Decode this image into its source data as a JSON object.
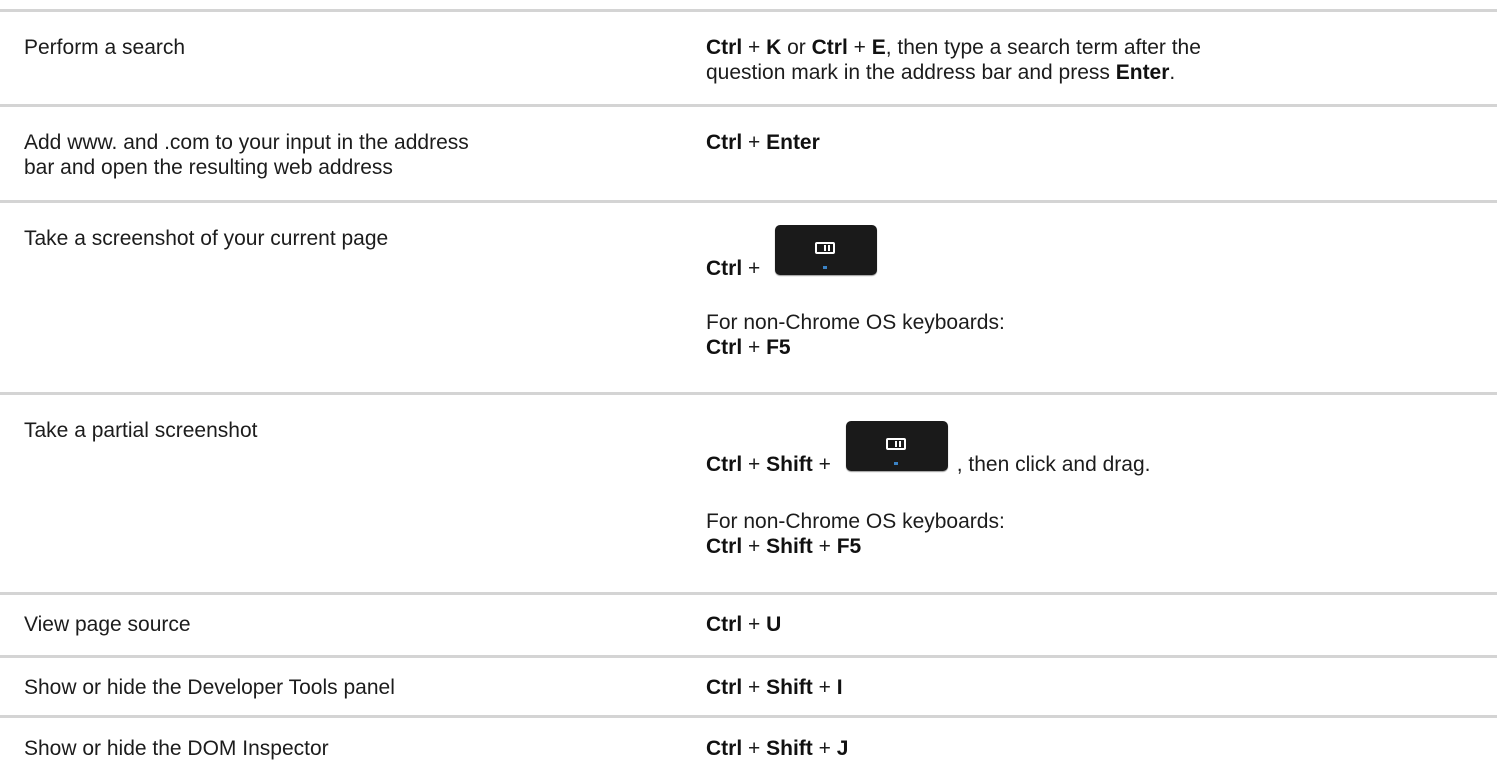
{
  "rows": [
    {
      "action": "Perform a search",
      "line1": {
        "a": "Ctrl",
        "b": " + ",
        "c": "K",
        "d": " or ",
        "e": "Ctrl",
        "f": " + ",
        "g": "E",
        "h": ", then type a search term after the"
      },
      "line2": {
        "a": "question mark in the address bar and press ",
        "b": "Enter",
        "c": "."
      }
    },
    {
      "action_line1": "Add www. and .com to your input in the address",
      "action_line2": "bar and open the resulting web address",
      "line1": {
        "a": "Ctrl",
        "b": " + ",
        "c": "Enter"
      }
    },
    {
      "action": "Take a screenshot of your current page",
      "line1": {
        "a": "Ctrl",
        "b": " + "
      },
      "key_icon": "show-windows-key-icon",
      "note": "For non-Chrome OS keyboards:",
      "alt": {
        "a": "Ctrl",
        "b": " + ",
        "c": "F5"
      }
    },
    {
      "action": "Take a partial screenshot",
      "line1": {
        "a": "Ctrl",
        "b": " + ",
        "c": "Shift",
        "d": " + ",
        "e": ", then click and drag."
      },
      "key_icon": "show-windows-key-icon",
      "note": "For non-Chrome OS keyboards:",
      "alt": {
        "a": "Ctrl",
        "b": " + ",
        "c": "Shift",
        "d": " + ",
        "e": "F5"
      }
    },
    {
      "action": "View page source",
      "line1": {
        "a": "Ctrl",
        "b": " + ",
        "c": "U"
      }
    },
    {
      "action": "Show or hide the Developer Tools panel",
      "line1": {
        "a": "Ctrl",
        "b": " + ",
        "c": "Shift",
        "d": " + ",
        "e": "I"
      }
    },
    {
      "action": "Show or hide the DOM Inspector",
      "line1": {
        "a": "Ctrl",
        "b": " + ",
        "c": "Shift",
        "d": " + ",
        "e": "J"
      }
    }
  ],
  "colors": {
    "divider": "#d4d4d4",
    "text": "#1c1c1c",
    "key_background": "#1a1a1a"
  }
}
